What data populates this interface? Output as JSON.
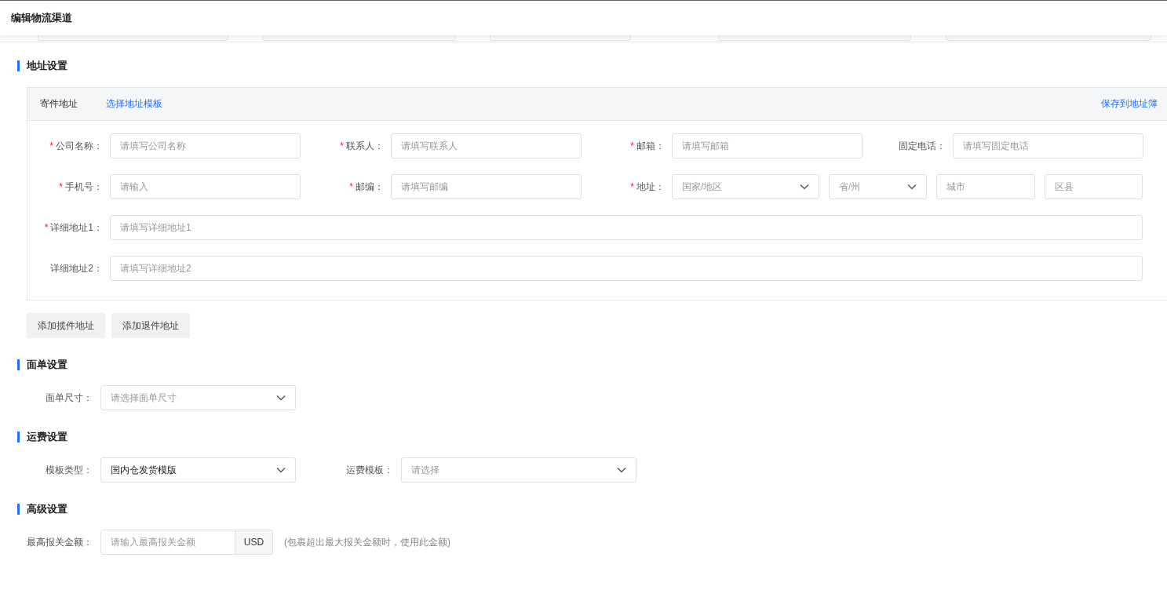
{
  "dialog_title": "编辑物流渠道",
  "sections": [
    {
      "kind": "address",
      "title": "地址设置",
      "card": {
        "label": "寄件地址",
        "template_link": "选择地址模板",
        "save_link": "保存到地址簿",
        "rows": [
          [
            {
              "mark": "*",
              "label": "公司名称：",
              "controls": [
                {
                  "kind": "input",
                  "placeholder": "请填写公司名称"
                }
              ]
            },
            {
              "mark": "*",
              "label": "联系人：",
              "controls": [
                {
                  "kind": "input",
                  "placeholder": "请填写联系人"
                }
              ]
            },
            {
              "mark": "*",
              "label": "邮箱：",
              "controls": [
                {
                  "kind": "input",
                  "placeholder": "请填写邮箱"
                }
              ]
            },
            {
              "label": "固定电话：",
              "controls": [
                {
                  "kind": "input",
                  "placeholder": "请填写固定电话"
                }
              ]
            }
          ],
          [
            {
              "mark": "*",
              "label": "手机号：",
              "controls": [
                {
                  "kind": "input",
                  "placeholder": "请输入"
                }
              ]
            },
            {
              "mark": "*",
              "label": "邮编：",
              "controls": [
                {
                  "kind": "input",
                  "placeholder": "请填写邮编"
                }
              ]
            },
            {
              "mark": "*",
              "label": "地址：",
              "controls": [
                {
                  "kind": "select",
                  "placeholder": "国家/地区"
                },
                {
                  "kind": "select",
                  "placeholder": "省/州"
                },
                {
                  "kind": "input",
                  "placeholder": "城市"
                },
                {
                  "kind": "input",
                  "placeholder": "区县"
                }
              ]
            }
          ],
          [
            {
              "mark": "*",
              "label": "详细地址1：",
              "controls": [
                {
                  "kind": "input",
                  "placeholder": "请填写详细地址1"
                }
              ]
            }
          ],
          [
            {
              "label": "详细地址2：",
              "controls": [
                {
                  "kind": "input",
                  "placeholder": "请填写详细地址2"
                }
              ]
            }
          ]
        ]
      },
      "buttons": [
        "添加揽件地址",
        "添加退件地址"
      ]
    },
    {
      "kind": "form",
      "title": "面单设置",
      "items": [
        {
          "label": "面单尺寸：",
          "control": {
            "kind": "select",
            "placeholder": "请选择面单尺寸"
          }
        }
      ]
    },
    {
      "kind": "form",
      "title": "运费设置",
      "items": [
        {
          "label": "模板类型：",
          "control": {
            "kind": "select",
            "value": "国内仓发货模版"
          }
        },
        {
          "label": "运费模板：",
          "control": {
            "kind": "select",
            "placeholder": "请选择"
          }
        }
      ]
    },
    {
      "kind": "form",
      "title": "高级设置",
      "items": [
        {
          "label": "最高报关金额：",
          "control": {
            "kind": "addon-input",
            "placeholder": "请输入最高报关金额",
            "addon": "USD"
          },
          "hint": "(包裹超出最大报关金额时，使用此金额)"
        }
      ]
    }
  ]
}
